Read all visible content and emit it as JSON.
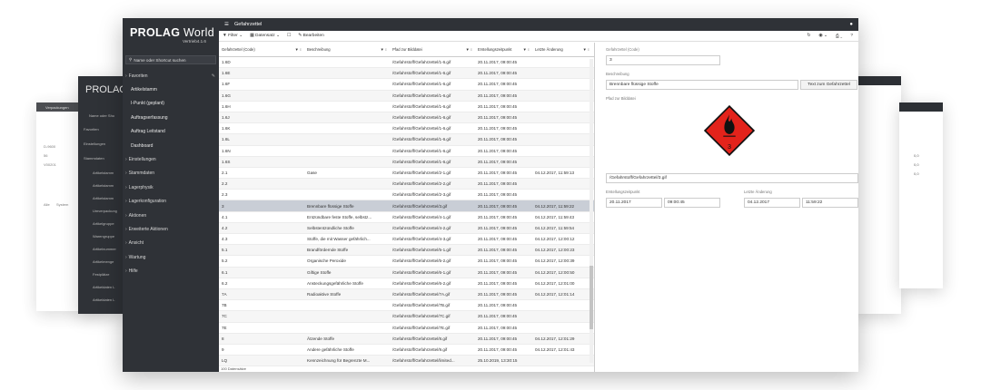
{
  "app": {
    "logo_bold": "PROLAG",
    "logo_light": " World",
    "version": "Vertrieb4.1.6"
  },
  "search": {
    "placeholder": "Name oder Shortcut suchen"
  },
  "sidebar": {
    "items": [
      {
        "label": "Favoriten",
        "type": "header"
      },
      {
        "label": "Artikelstamm",
        "type": "sub"
      },
      {
        "label": "I-Punkt (geplant)",
        "type": "sub"
      },
      {
        "label": "Auftragserfassung",
        "type": "sub"
      },
      {
        "label": "Auftrag Leitstand",
        "type": "sub"
      },
      {
        "label": "Dashboard",
        "type": "sub"
      },
      {
        "label": "Einstellungen",
        "type": "header"
      },
      {
        "label": "Stammdaten",
        "type": "header"
      },
      {
        "label": "Lagerphysik",
        "type": "header"
      },
      {
        "label": "Lagerkonfiguration",
        "type": "header"
      },
      {
        "label": "Aktionen",
        "type": "header"
      },
      {
        "label": "Erweiterte Aktionen",
        "type": "header"
      },
      {
        "label": "Ansicht",
        "type": "header"
      },
      {
        "label": "Wartung",
        "type": "header"
      },
      {
        "label": "Hilfe",
        "type": "header"
      }
    ]
  },
  "topbar": {
    "title": "Gefahrzettel"
  },
  "toolbar": {
    "filter": "Filter",
    "datensatz": "Datensatz",
    "bearbeiten": "Bearbeiten"
  },
  "grid": {
    "columns": [
      "Gefahrzettel (Code)",
      "Beschreibung",
      "Pfad zur Bilddatei",
      "Erstellungszeitpunkt",
      "Letzte Änderung"
    ],
    "rows": [
      [
        "1.6D",
        "",
        "/Gefahrstoff/Gefahrzettel/1-6.gif",
        "20.11.2017, 09:00:45",
        ""
      ],
      [
        "1.6E",
        "",
        "/Gefahrstoff/Gefahrzettel/1-6.gif",
        "20.11.2017, 09:00:45",
        ""
      ],
      [
        "1.6F",
        "",
        "/Gefahrstoff/Gefahrzettel/1-6.gif",
        "20.11.2017, 09:00:45",
        ""
      ],
      [
        "1.6G",
        "",
        "/Gefahrstoff/Gefahrzettel/1-6.gif",
        "20.11.2017, 09:00:45",
        ""
      ],
      [
        "1.6H",
        "",
        "/Gefahrstoff/Gefahrzettel/1-6.gif",
        "20.11.2017, 09:00:45",
        ""
      ],
      [
        "1.6J",
        "",
        "/Gefahrstoff/Gefahrzettel/1-6.gif",
        "20.11.2017, 09:00:45",
        ""
      ],
      [
        "1.6K",
        "",
        "/Gefahrstoff/Gefahrzettel/1-6.gif",
        "20.11.2017, 09:00:45",
        ""
      ],
      [
        "1.6L",
        "",
        "/Gefahrstoff/Gefahrzettel/1-6.gif",
        "20.11.2017, 09:00:45",
        ""
      ],
      [
        "1.6N",
        "",
        "/Gefahrstoff/Gefahrzettel/1-6.gif",
        "20.11.2017, 09:00:45",
        ""
      ],
      [
        "1.6S",
        "",
        "/Gefahrstoff/Gefahrzettel/1-6.gif",
        "20.11.2017, 09:00:45",
        ""
      ],
      [
        "2.1",
        "Gase",
        "/Gefahrstoff/Gefahrzettel/2-1.gif",
        "20.11.2017, 09:00:45",
        "04.12.2017, 11:59:13"
      ],
      [
        "2.2",
        "",
        "/Gefahrstoff/Gefahrzettel/2-2.gif",
        "20.11.2017, 09:00:45",
        ""
      ],
      [
        "2.3",
        "",
        "/Gefahrstoff/Gefahrzettel/2-3.gif",
        "20.11.2017, 09:00:45",
        ""
      ],
      [
        "3",
        "Brennbare flüssige Stoffe",
        "/Gefahrstoff/Gefahrzettel/3.gif",
        "20.11.2017, 09:00:45",
        "04.12.2017, 11:59:22"
      ],
      [
        "4.1",
        "Entzündbare feste Stoffe, selbstz...",
        "/Gefahrstoff/Gefahrzettel/4-1.gif",
        "20.11.2017, 09:00:45",
        "04.12.2017, 11:59:43"
      ],
      [
        "4.2",
        "Selbstentzündliche Stoffe",
        "/Gefahrstoff/Gefahrzettel/4-2.gif",
        "20.11.2017, 09:00:45",
        "04.12.2017, 11:59:54"
      ],
      [
        "4.3",
        "Stoffe, die mit Wasser gefährlich...",
        "/Gefahrstoff/Gefahrzettel/4-3.gif",
        "20.11.2017, 09:00:45",
        "04.12.2017, 12:00:12"
      ],
      [
        "5.1",
        "Brandfördernde Stoffe",
        "/Gefahrstoff/Gefahrzettel/5-1.gif",
        "20.11.2017, 09:00:45",
        "04.12.2017, 12:00:23"
      ],
      [
        "5.2",
        "Organische Peroxide",
        "/Gefahrstoff/Gefahrzettel/5-2.gif",
        "20.11.2017, 09:00:45",
        "04.12.2017, 12:00:39"
      ],
      [
        "6.1",
        "Giftige Stoffe",
        "/Gefahrstoff/Gefahrzettel/6-1.gif",
        "20.11.2017, 09:00:45",
        "04.12.2017, 12:00:50"
      ],
      [
        "6.2",
        "Ansteckungsgefährliche Stoffe",
        "/Gefahrstoff/Gefahrzettel/6-2.gif",
        "20.11.2017, 09:00:45",
        "04.12.2017, 12:01:00"
      ],
      [
        "7A",
        "Radioaktive Stoffe",
        "/Gefahrstoff/Gefahrzettel/7A.gif",
        "20.11.2017, 09:00:45",
        "04.12.2017, 12:01:14"
      ],
      [
        "7B",
        "",
        "/Gefahrstoff/Gefahrzettel/7B.gif",
        "20.11.2017, 09:00:45",
        ""
      ],
      [
        "7C",
        "",
        "/Gefahrstoff/Gefahrzettel/7C.gif",
        "20.11.2017, 09:00:45",
        ""
      ],
      [
        "7E",
        "",
        "/Gefahrstoff/Gefahrzettel/7E.gif",
        "20.11.2017, 09:00:45",
        ""
      ],
      [
        "8",
        "Ätzende Stoffe",
        "/Gefahrstoff/Gefahrzettel/8.gif",
        "20.11.2017, 09:00:45",
        "04.12.2017, 12:01:29"
      ],
      [
        "9",
        "Andere gefährliche Stoffe",
        "/Gefahrstoff/Gefahrzettel/9.gif",
        "20.11.2017, 09:00:45",
        "04.12.2017, 12:01:43"
      ],
      [
        "LQ",
        "Kennzeichnung für Begrenzte M...",
        "/Gefahrstoff/Gefahrzettel/limited...",
        "25.10.2019, 13:30:15",
        ""
      ]
    ],
    "selected_index": 13,
    "footer": "100 Datensätze"
  },
  "detail": {
    "code_label": "Gefahrzettel (Code)",
    "code_value": "3",
    "desc_label": "Beschreibung",
    "desc_value": "Brennbare flüssige Stoffe",
    "text_button": "Text zum Gefahrzettel",
    "path_label": "Pfad zur Bilddatei",
    "path_value": "/Gefahrstoff/Gefahrzettel/3.gif",
    "hazard_number": "3",
    "created_label": "Erstellungszeitpunkt",
    "created_date": "20.11.2017",
    "created_time": "09:00:45",
    "changed_label": "Letzte Änderung",
    "changed_date": "04.12.2017",
    "changed_time": "11:59:22"
  },
  "ghost": {
    "left_title": "Verpackungen",
    "left_rows": [
      "D-9600",
      "56",
      "V00201"
    ],
    "left_tabs": [
      "Alle",
      "System"
    ],
    "mid_logo": "PROLAG",
    "mid_search": "Name oder Sho",
    "mid_items": [
      "Favoriten",
      "Einstellungen",
      "Stammdaten",
      "Artikelstamm",
      "Artikelstamm",
      "Artikelstamm",
      "Umverpackung",
      "Artikelgruppe",
      "Warengruppe",
      "Artikelnummer",
      "Artikelmenge",
      "Festplätze",
      "Artikeldaten L",
      "Artikeldaten L"
    ],
    "far_values": [
      "0,0",
      "0,0",
      "0,0"
    ]
  },
  "colors": {
    "sidebar": "#2f3237",
    "selected_row": "#c9ced6",
    "hazard_red": "#e3231b"
  }
}
